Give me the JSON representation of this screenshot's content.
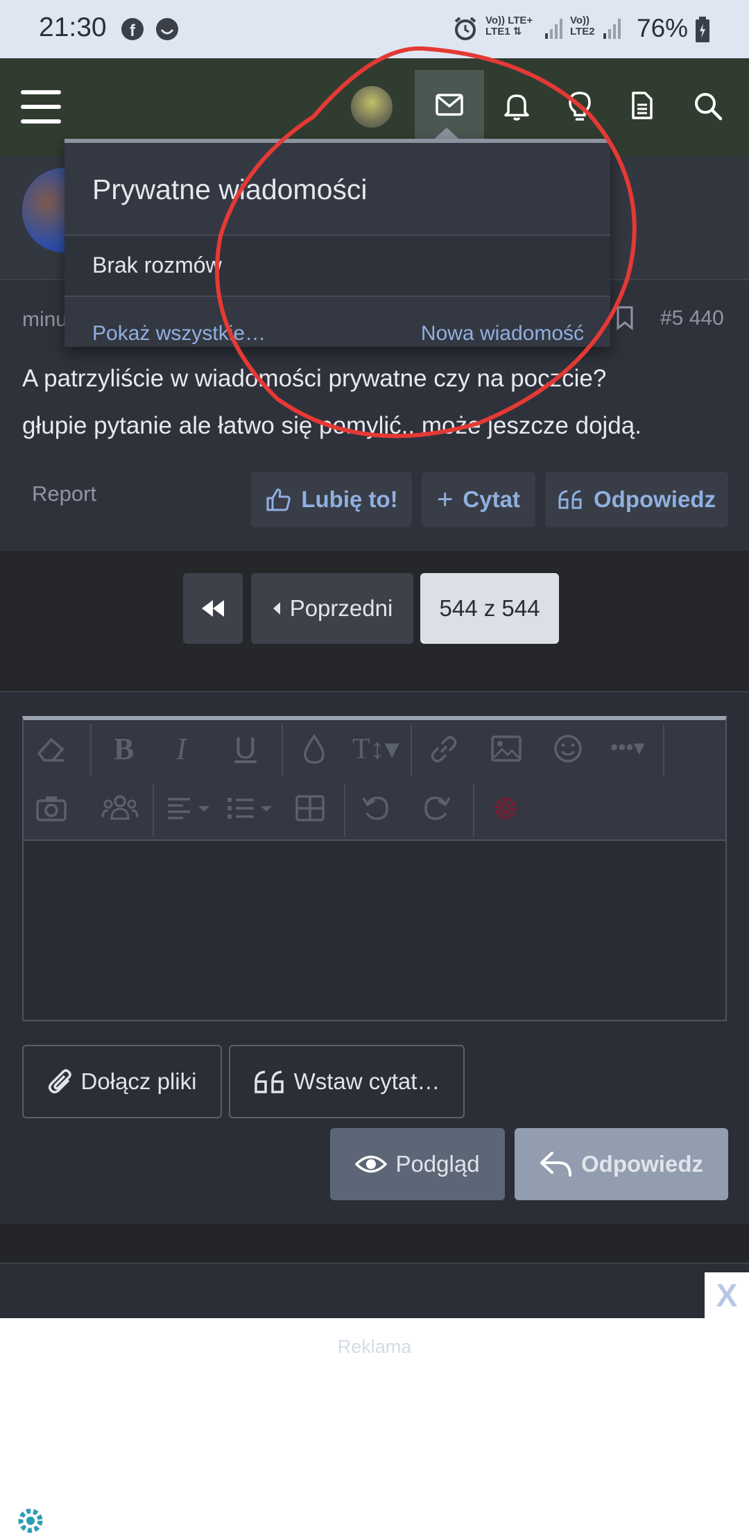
{
  "status_bar": {
    "time": "21:30",
    "battery": "76%",
    "sim1": "LTE1",
    "sim2": "LTE2",
    "net1": "LTE+",
    "volte": "Vo))"
  },
  "header": {
    "icons": [
      "menu-icon",
      "avatar",
      "mail-icon",
      "bell-icon",
      "lightbulb-icon",
      "document-icon",
      "search-icon"
    ]
  },
  "dropdown": {
    "title": "Prywatne wiadomości",
    "empty_text": "Brak rozmów",
    "show_all": "Pokaż wszystkie…",
    "new_message": "Nowa wiadomość"
  },
  "post": {
    "meta_left": "minu",
    "post_number": "#5 440",
    "body_line1": "A patrzyliście w wiadomości prywatne czy na poczcie?",
    "body_line2": "głupie pytanie ale łatwo się pomylić.. może jeszcze dojdą.",
    "report": "Report",
    "like": "Lubię to!",
    "quote": "Cytat",
    "reply": "Odpowiedz"
  },
  "pagination": {
    "previous": "Poprzedni",
    "current": "544 z 544"
  },
  "editor": {
    "attach": "Dołącz pliki",
    "insert_quote": "Wstaw cytat…",
    "preview": "Podgląd",
    "reply": "Odpowiedz"
  },
  "ad": {
    "label": "Reklama",
    "close": "X"
  },
  "colors": {
    "accent": "#8fb0e0",
    "header_bg": "#313c30",
    "annotation": "#e53935"
  }
}
